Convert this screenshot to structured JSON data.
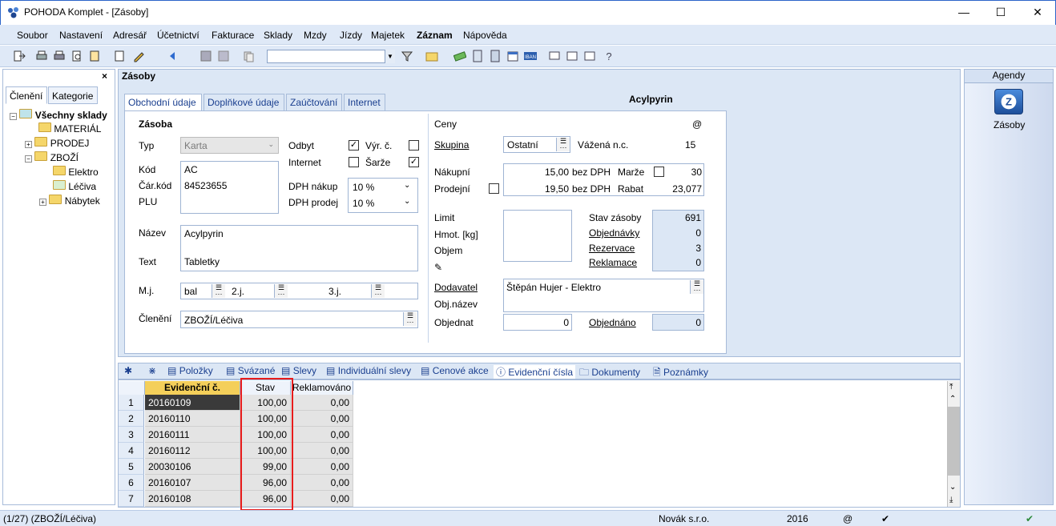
{
  "window": {
    "title": "POHODA Komplet - [Zásoby]"
  },
  "menu": [
    "Soubor",
    "Nastavení",
    "Adresář",
    "Účetnictví",
    "Fakturace",
    "Sklady",
    "Mzdy",
    "Jízdy",
    "Majetek",
    "Záznam",
    "Nápověda"
  ],
  "left": {
    "tabs": [
      "Členění",
      "Kategorie"
    ],
    "tree": {
      "root": "Všechny sklady",
      "items": [
        "MATERIÁL",
        "PRODEJ",
        "ZBOŽÍ",
        "Elektro",
        "Léčiva",
        "Nábytek"
      ]
    }
  },
  "main": {
    "title": "Zásoby",
    "tabs": [
      "Obchodní údaje",
      "Doplňkové údaje",
      "Zaúčtování",
      "Internet"
    ],
    "product_name": "Acylpyrin"
  },
  "zasoba": {
    "section": "Zásoba",
    "typ_label": "Typ",
    "typ_value": "Karta",
    "kod_label": "Kód",
    "kod_value": "AC",
    "carkod_label": "Čár.kód",
    "carkod_value": "84523655",
    "plu_label": "PLU",
    "odbyt_label": "Odbyt",
    "odbyt_checked": "✓",
    "internet_label": "Internet",
    "vyrc_label": "Výr. č.",
    "sarze_label": "Šarže",
    "sarze_checked": "✓",
    "dph_nakup_label": "DPH nákup",
    "dph_nakup_value": "10 %",
    "dph_prodej_label": "DPH prodej",
    "dph_prodej_value": "10 %",
    "nazev_label": "Název",
    "nazev_value": "Acylpyrin",
    "text_label": "Text",
    "text_value": "Tabletky",
    "mj_label": "M.j.",
    "mj_value": "bal",
    "j2_label": "2.j.",
    "j3_label": "3.j.",
    "cleneni_label": "Členění",
    "cleneni_value": "ZBOŽÍ/Léčiva"
  },
  "ceny": {
    "section": "Ceny",
    "at": "@",
    "skupina_label": "Skupina",
    "skupina_value": "Ostatní",
    "vazena_label": "Vážená n.c.",
    "vazena_value": "15",
    "nakupni_label": "Nákupní",
    "nakupni_value": "15,00",
    "nakupni_dph": "bez DPH",
    "prodejni_label": "Prodejní",
    "prodejni_value": "19,50",
    "prodejni_dph": "bez DPH",
    "marze_label": "Marže",
    "marze_value": "30",
    "rabat_label": "Rabat",
    "rabat_value": "23,077",
    "limit_label": "Limit",
    "hmot_label": "Hmot. [kg]",
    "objem_label": "Objem",
    "stav_label": "Stav zásoby",
    "stav_value": "691",
    "objednavky_label": "Objednávky",
    "objednavky_value": "0",
    "rezervace_label": "Rezervace",
    "rezervace_value": "3",
    "reklamace_label": "Reklamace",
    "reklamace_value": "0",
    "dodavatel_label": "Dodavatel",
    "dodavatel_value": "Štěpán Hujer - Elektro",
    "objnazev_label": "Obj.název",
    "objednat_label": "Objednat",
    "objednat_value": "0",
    "objednano_label": "Objednáno",
    "objednano_value": "0"
  },
  "agenda": {
    "header": "Agendy",
    "item": "Zásoby"
  },
  "lower_tabs": [
    "Položky",
    "Svázané",
    "Slevy",
    "Individuální slevy",
    "Cenové akce",
    "Evidenční čísla",
    "Dokumenty",
    "Poznámky"
  ],
  "grid": {
    "headers": [
      "Evidenční č.",
      "Stav",
      "Reklamováno"
    ],
    "rows": [
      {
        "n": "1",
        "ev": "20160109",
        "stav": "100,00",
        "rek": "0,00"
      },
      {
        "n": "2",
        "ev": "20160110",
        "stav": "100,00",
        "rek": "0,00"
      },
      {
        "n": "3",
        "ev": "20160111",
        "stav": "100,00",
        "rek": "0,00"
      },
      {
        "n": "4",
        "ev": "20160112",
        "stav": "100,00",
        "rek": "0,00"
      },
      {
        "n": "5",
        "ev": "20030106",
        "stav": "99,00",
        "rek": "0,00"
      },
      {
        "n": "6",
        "ev": "20160107",
        "stav": "96,00",
        "rek": "0,00"
      },
      {
        "n": "7",
        "ev": "20160108",
        "stav": "96,00",
        "rek": "0,00"
      }
    ]
  },
  "status": {
    "left": "(1/27) (ZBOŽÍ/Léčiva)",
    "company": "Novák s.r.o.",
    "year": "2016",
    "at": "@"
  }
}
